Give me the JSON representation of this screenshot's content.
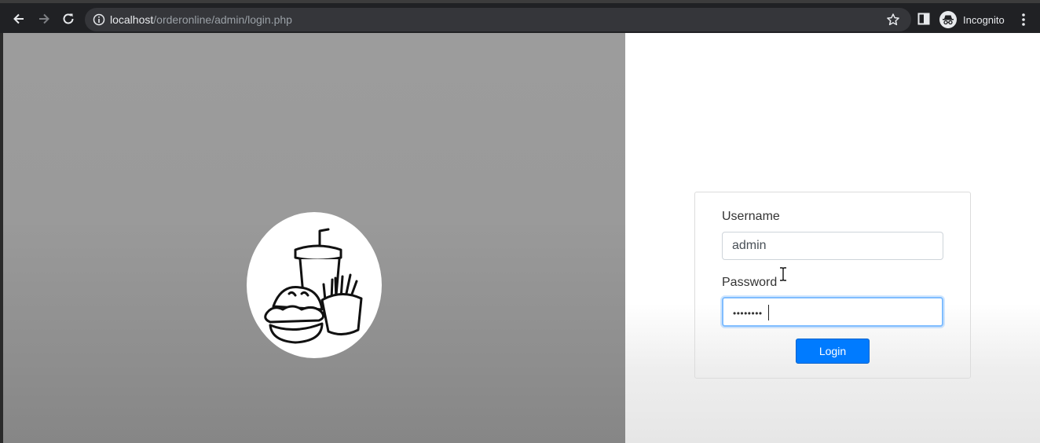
{
  "browser": {
    "url_host": "localhost",
    "url_path": "/orderonline/admin/login.php",
    "profile_label": "Incognito"
  },
  "login": {
    "username_label": "Username",
    "username_value": "admin",
    "password_label": "Password",
    "password_value": "••••••••",
    "login_button": "Login"
  },
  "icons": {
    "logo": "fast-food-logo",
    "back": "back-arrow-icon",
    "forward": "forward-arrow-icon",
    "reload": "reload-icon",
    "info": "info-icon",
    "bookmark": "star-icon",
    "side_panel": "side-panel-icon",
    "incognito": "incognito-icon",
    "menu": "kebab-menu-icon"
  },
  "colors": {
    "primary_button": "#007bff",
    "input_focus": "#80bdff",
    "left_panel": "#9a9a9a"
  }
}
